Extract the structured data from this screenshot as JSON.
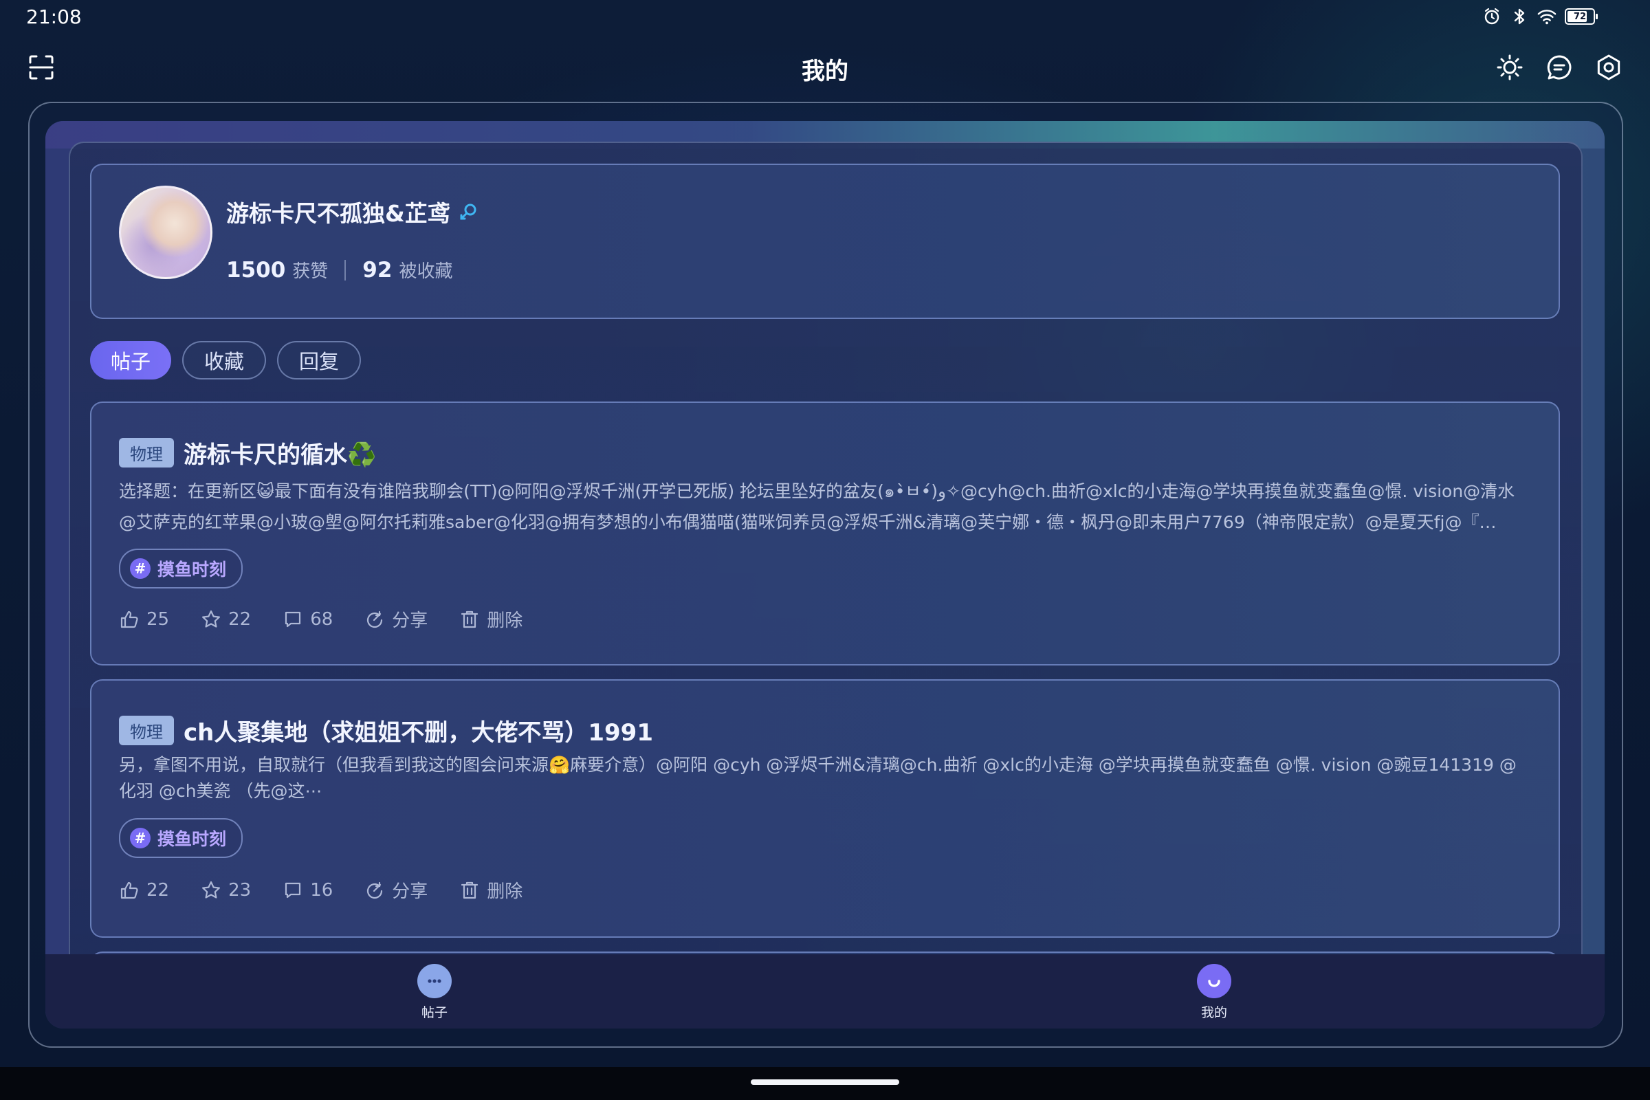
{
  "status_bar": {
    "time": "21:08",
    "battery": "72",
    "icons": [
      "alarm-icon",
      "bluetooth-icon",
      "wifi-icon",
      "battery-icon"
    ]
  },
  "header": {
    "title": "我的",
    "left_icon": "scan-icon",
    "right_icons": [
      "brightness-icon",
      "message-icon",
      "settings-icon"
    ]
  },
  "profile": {
    "username": "游标卡尺不孤独&芷鸢",
    "gender_icon": "female-icon",
    "likes_count": "1500",
    "likes_label": "获赞",
    "favorites_count": "92",
    "favorites_label": "被收藏"
  },
  "tabs": [
    {
      "label": "帖子",
      "active": true
    },
    {
      "label": "收藏",
      "active": false
    },
    {
      "label": "回复",
      "active": false
    }
  ],
  "posts": [
    {
      "tag": "物理",
      "title": "游标卡尺的循水♻️",
      "body_line1": "选择题：在更新区😺最下面有没有谁陪我聊会(TT)@阿阳@浮烬千洲(开学已死版) 抡坛里坠好的盆友(๑•̀ㅂ•́)و✧@cyh@ch.曲祈@xlc的小走海@学块再摸鱼就变蠢鱼@憬. vision@清水",
      "body_line2": "@艾萨克的红苹果@小玻@塱@阿尔托莉雅saber@化羽@拥有梦想的小布偶猫喵(猫咪饲养员@浮烬千洲&清璃@芙宁娜・德・枫丹@即未用户7769（神帝限定款）@是夏天fj@『…",
      "hashtag": "摸鱼时刻",
      "likes": "25",
      "stars": "22",
      "comments": "68",
      "share_label": "分享",
      "delete_label": "删除"
    },
    {
      "tag": "物理",
      "title": "ch人聚集地（求姐姐不删，大佬不骂）1991",
      "body_line1": "另，拿图不用说，自取就行（但我看到我这的图会问来源🤗麻要介意）@阿阳 @cyh @浮烬千洲&清璃@ch.曲祈 @xlc的小走海 @学块再摸鱼就变蠢鱼 @憬. vision @豌豆141319 @",
      "body_line2": "化羽 @ch美瓷 （先@这⋯",
      "hashtag": "摸鱼时刻",
      "likes": "22",
      "stars": "23",
      "comments": "16",
      "share_label": "分享",
      "delete_label": "删除"
    }
  ],
  "bottom_nav": [
    {
      "label": "帖子",
      "icon": "chat-bubble-icon",
      "active": false
    },
    {
      "label": "我的",
      "icon": "profile-smile-icon",
      "active": true
    }
  ],
  "colors": {
    "accent": "#6a66ee",
    "hashtag_text": "#b9a8ff",
    "tag_bg": "#9fb7e4",
    "nav_post_icon": "#8aa6e8",
    "nav_me_icon": "#7a6cf4"
  }
}
